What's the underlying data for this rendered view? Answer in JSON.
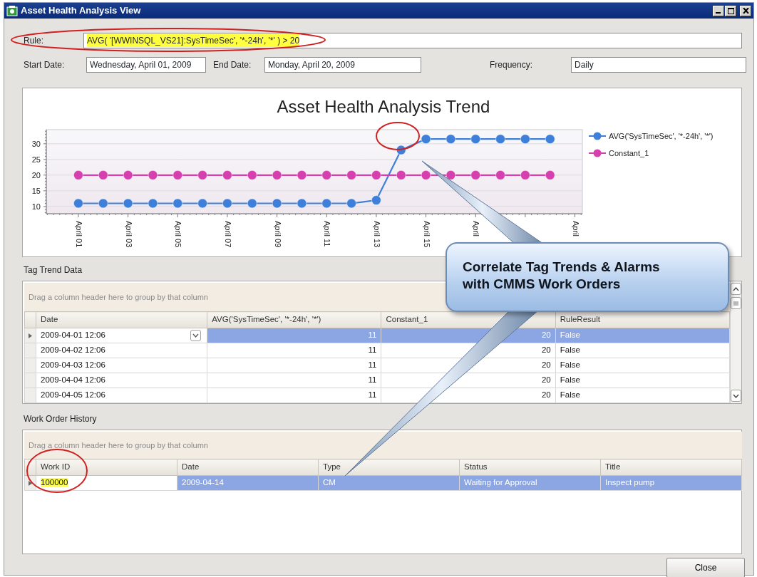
{
  "window": {
    "title": "Asset Health Analysis View"
  },
  "rule": {
    "label": "Rule:",
    "value": "AVG( '[WWINSQL_VS21]:SysTimeSec', '*-24h', '*' ) > 20",
    "highlighted": true
  },
  "dates": [
    {
      "label": "Start Date:",
      "value": "Wednesday, April 01, 2009"
    },
    {
      "label": "End Date:",
      "value": "Monday, April 20, 2009"
    }
  ],
  "frequency": {
    "label": "Frequency:",
    "value": "Daily"
  },
  "chart": {
    "chart_data": {
      "type": "line",
      "title": "Asset Health Analysis Trend",
      "categories": [
        "April 01",
        null,
        "April 03",
        null,
        "April 05",
        null,
        "April 07",
        null,
        "April 09",
        null,
        "April 11",
        null,
        "April 13",
        null,
        "April 15",
        null,
        "April",
        null,
        null,
        null,
        "April"
      ],
      "series": [
        {
          "name": "AVG('SysTimeSec', '*-24h', '*')",
          "color": "#3d7fd9",
          "marker": "circle",
          "values": [
            11,
            11,
            11,
            11,
            11,
            11,
            11,
            11,
            11,
            11,
            11,
            11,
            12,
            28,
            31.5,
            31.5,
            31.5,
            31.5,
            31.5,
            31.5,
            null
          ]
        },
        {
          "name": "Constant_1",
          "color": "#d63fae",
          "marker": "circle",
          "values": [
            20,
            20,
            20,
            20,
            20,
            20,
            20,
            20,
            20,
            20,
            20,
            20,
            20,
            20,
            20,
            20,
            20,
            20,
            20,
            20,
            null
          ]
        }
      ],
      "ylim": [
        7.7,
        34.5
      ],
      "yticks": [
        10,
        15,
        20,
        25,
        30
      ],
      "grid": true,
      "legend": "right"
    }
  },
  "tag_trend": {
    "title": "Tag Trend Data",
    "group_hint": "Drag a column header here to group by that column",
    "columns": [
      "Date",
      "AVG('SysTimeSec', '*-24h', '*')",
      "Constant_1",
      "RuleResult"
    ],
    "rows": [
      {
        "cells": [
          "2009-04-01 12:06",
          "11",
          "20",
          "False"
        ],
        "selected": true
      },
      {
        "cells": [
          "2009-04-02 12:06",
          "11",
          "20",
          "False"
        ],
        "selected": false
      },
      {
        "cells": [
          "2009-04-03 12:06",
          "11",
          "20",
          "False"
        ],
        "selected": false
      },
      {
        "cells": [
          "2009-04-04 12:06",
          "11",
          "20",
          "False"
        ],
        "selected": false
      },
      {
        "cells": [
          "2009-04-05 12:06",
          "11",
          "20",
          "False"
        ],
        "selected": false
      }
    ]
  },
  "work_orders": {
    "title": "Work Order History",
    "group_hint": "Drag a column header here to group by that column",
    "columns": [
      "Work ID",
      "Date",
      "Type",
      "Status",
      "Title"
    ],
    "rows": [
      {
        "cells": [
          "100000",
          "2009-04-14",
          "CM",
          "Waiting for Approval",
          "Inspect pump"
        ],
        "selected": true,
        "id_highlighted": true
      }
    ]
  },
  "callout": {
    "lines": [
      "Correlate Tag Trends & Alarms",
      "with CMMS Work Orders"
    ]
  },
  "close_button": "Close"
}
